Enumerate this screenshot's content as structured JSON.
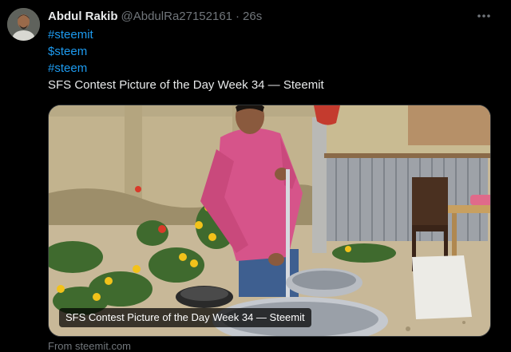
{
  "tweet": {
    "author_name": "Abdul Rakib",
    "handle": "@AbdulRa27152161",
    "separator": "·",
    "time": "26s",
    "lines": [
      {
        "text": "#steemit",
        "type": "link"
      },
      {
        "text": "$steem",
        "type": "link"
      },
      {
        "text": "#steem",
        "type": "link"
      },
      {
        "text": "SFS Contest Picture of the Day Week 34 — Steemit",
        "type": "text"
      }
    ],
    "card": {
      "caption": "SFS Contest Picture of the Day Week 34 — Steemit",
      "source": "From steemit.com"
    }
  },
  "icons": {
    "more": "more-horizontal-icon",
    "avatar": "user-avatar"
  },
  "colors": {
    "background": "#000000",
    "text": "#e7e9ea",
    "secondary": "#71767b",
    "link": "#1d9bf0"
  }
}
